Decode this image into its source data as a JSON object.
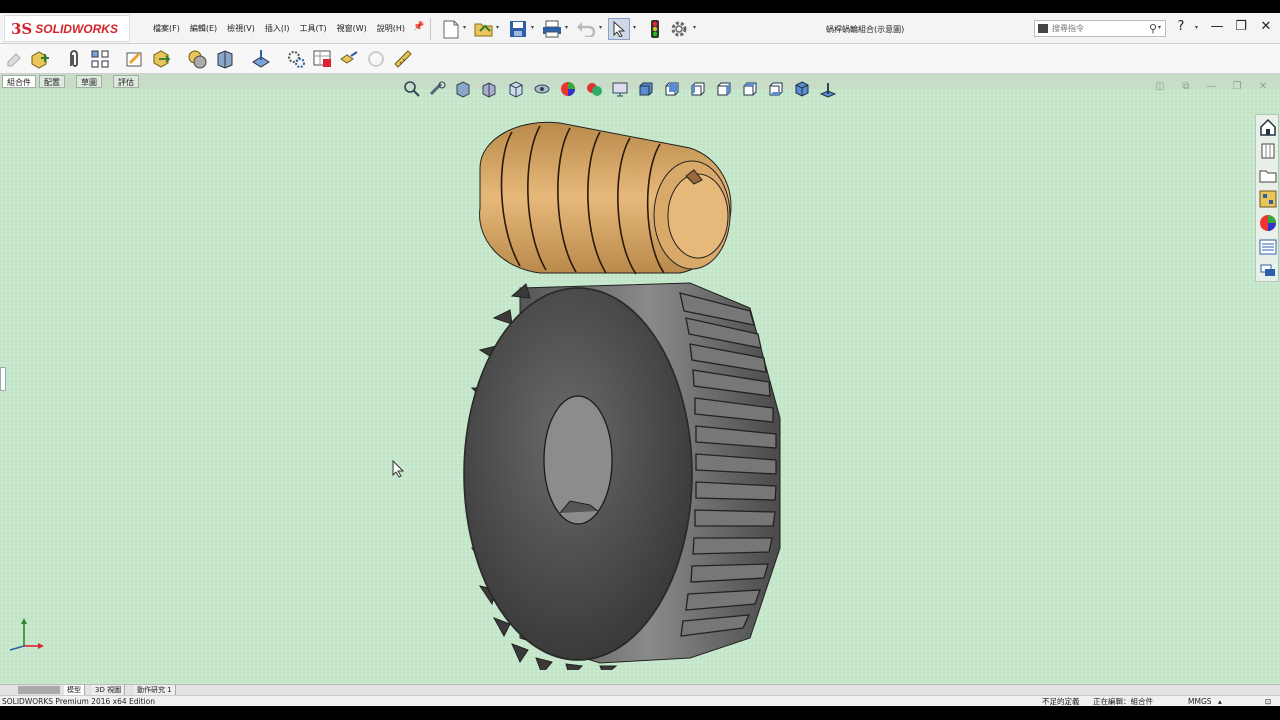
{
  "app": {
    "logo_prefix": "3S",
    "logo_text": "SOLIDWORKS",
    "document_title": "蝸桿蝸輪組合(示意圖)"
  },
  "menu": [
    "檔案(F)",
    "編輯(E)",
    "檢視(V)",
    "插入(I)",
    "工具(T)",
    "視窗(W)",
    "說明(H)"
  ],
  "search": {
    "placeholder": "搜尋指令"
  },
  "feature_tabs": [
    "組合件",
    "配置",
    "草圖",
    "評估"
  ],
  "bottom_tabs": [
    "模型",
    "3D 視圖",
    "動作研究 1"
  ],
  "status": {
    "product": "SOLIDWORKS Premium 2016 x64 Edition",
    "definition": "不足的定義",
    "editing": "正在編輯：組合件",
    "units": "MMGS",
    "units_arrow": "▴"
  },
  "window_controls": {
    "help": "?",
    "minimize": "—",
    "restore": "❐",
    "close": "✕"
  },
  "colors": {
    "viewport_bg": "#c3e6c9",
    "worm": "#d9a96a",
    "gear": "#4a4a4a",
    "accent_red": "#d2232a"
  }
}
